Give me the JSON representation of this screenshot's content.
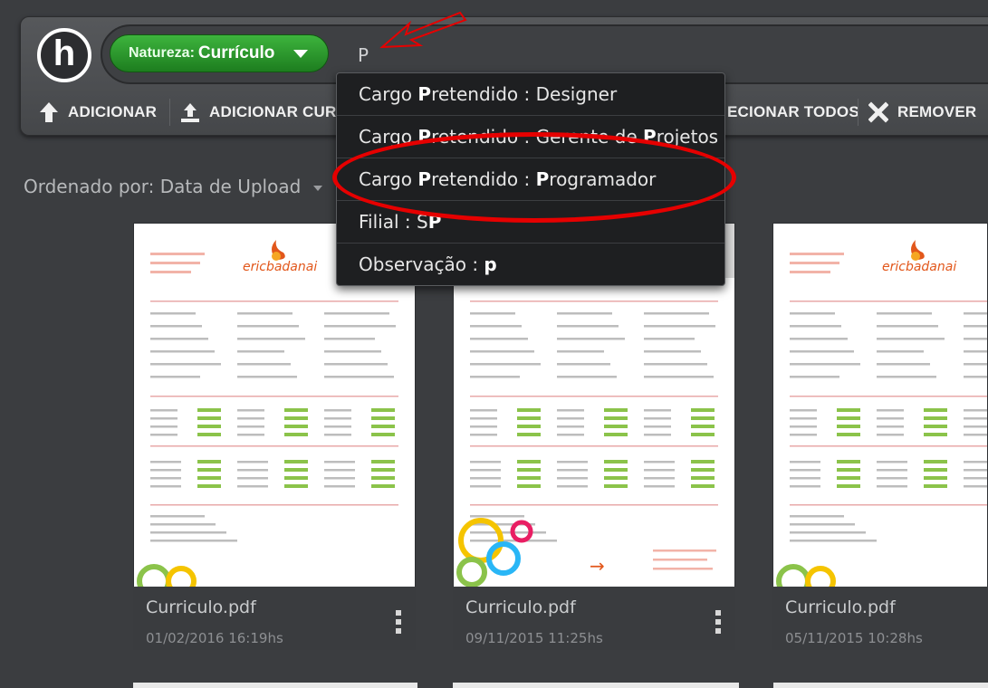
{
  "header": {
    "logo_letter": "h",
    "filter": {
      "key": "Natureza:",
      "value": "Currículo"
    },
    "query": "P"
  },
  "toolbar": {
    "add": "ADICIONAR",
    "add_curr": "ADICIONAR CURR",
    "select_all": "ECIONAR TODOS",
    "remove": "REMOVER"
  },
  "sort": {
    "label": "Ordenado por: Data de Upload"
  },
  "suggestions": [
    {
      "pre": "Cargo ",
      "m1": "P",
      "mid": "retendido : Designer",
      "m2": "",
      "post": ""
    },
    {
      "pre": "Cargo ",
      "m1": "P",
      "mid": "retendido : Gerente de ",
      "m2": "P",
      "post": "rojetos"
    },
    {
      "pre": "Cargo ",
      "m1": "P",
      "mid": "retendido : ",
      "m2": "P",
      "post": "rogramador"
    },
    {
      "pre": "Filial : S",
      "m1": "P",
      "mid": "",
      "m2": "",
      "post": ""
    },
    {
      "pre": "Observação : ",
      "m1": "p",
      "mid": "",
      "m2": "",
      "post": ""
    }
  ],
  "files": [
    {
      "name": "Curriculo.pdf",
      "date": "01/02/2016 16:19hs",
      "brand": "ericbadanai"
    },
    {
      "name": "Curriculo.pdf",
      "date": "09/11/2015 11:25hs",
      "brand": ""
    },
    {
      "name": "Curriculo.pdf",
      "date": "05/11/2015 10:28hs",
      "brand": "ericbadanai"
    }
  ],
  "colors": {
    "highlight": "#e60000",
    "accent_green": "#2a9a2c"
  }
}
